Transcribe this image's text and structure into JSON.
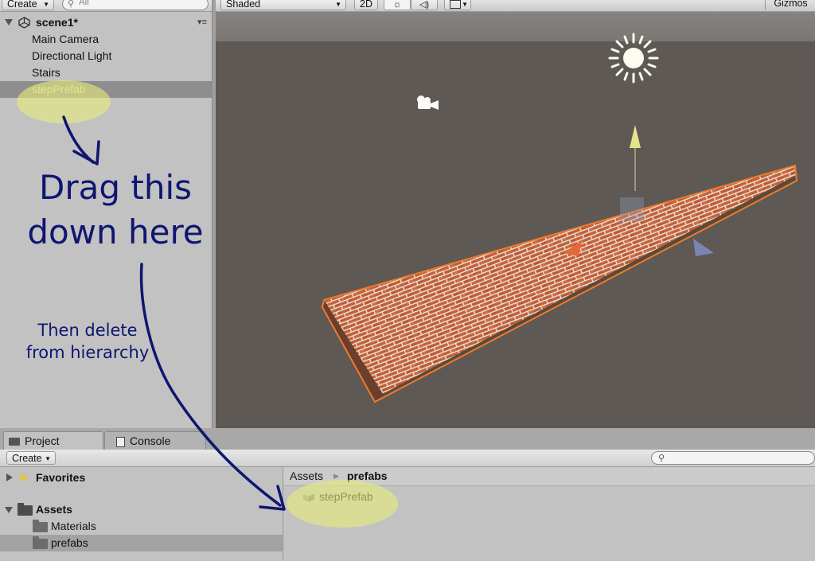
{
  "hierarchy": {
    "create_label": "Create",
    "search_placeholder": "All",
    "scene_name": "scene1*",
    "items": [
      "Main Camera",
      "Directional Light",
      "Stairs",
      "stepPrefab"
    ]
  },
  "scene_toolbar": {
    "shading_mode": "Shaded",
    "mode_2d": "2D",
    "gizmos_label": "Gizmos"
  },
  "bottom": {
    "tabs": [
      "Project",
      "Console"
    ],
    "create_label": "Create",
    "tree": {
      "favorites": "Favorites",
      "assets": "Assets",
      "children": [
        "Materials",
        "prefabs"
      ]
    },
    "breadcrumb": [
      "Assets",
      "prefabs"
    ],
    "asset_item": "stepPrefab"
  },
  "annotations": {
    "drag_line1": "Drag this",
    "drag_line2": "down here",
    "delete_line1": "Then delete",
    "delete_line2": "from hierarchy"
  },
  "colors": {
    "annotation_ink": "#0e1671",
    "highlight": "#e8ec78",
    "brick": "#c7633e",
    "selection_outline": "#f07a2a"
  }
}
